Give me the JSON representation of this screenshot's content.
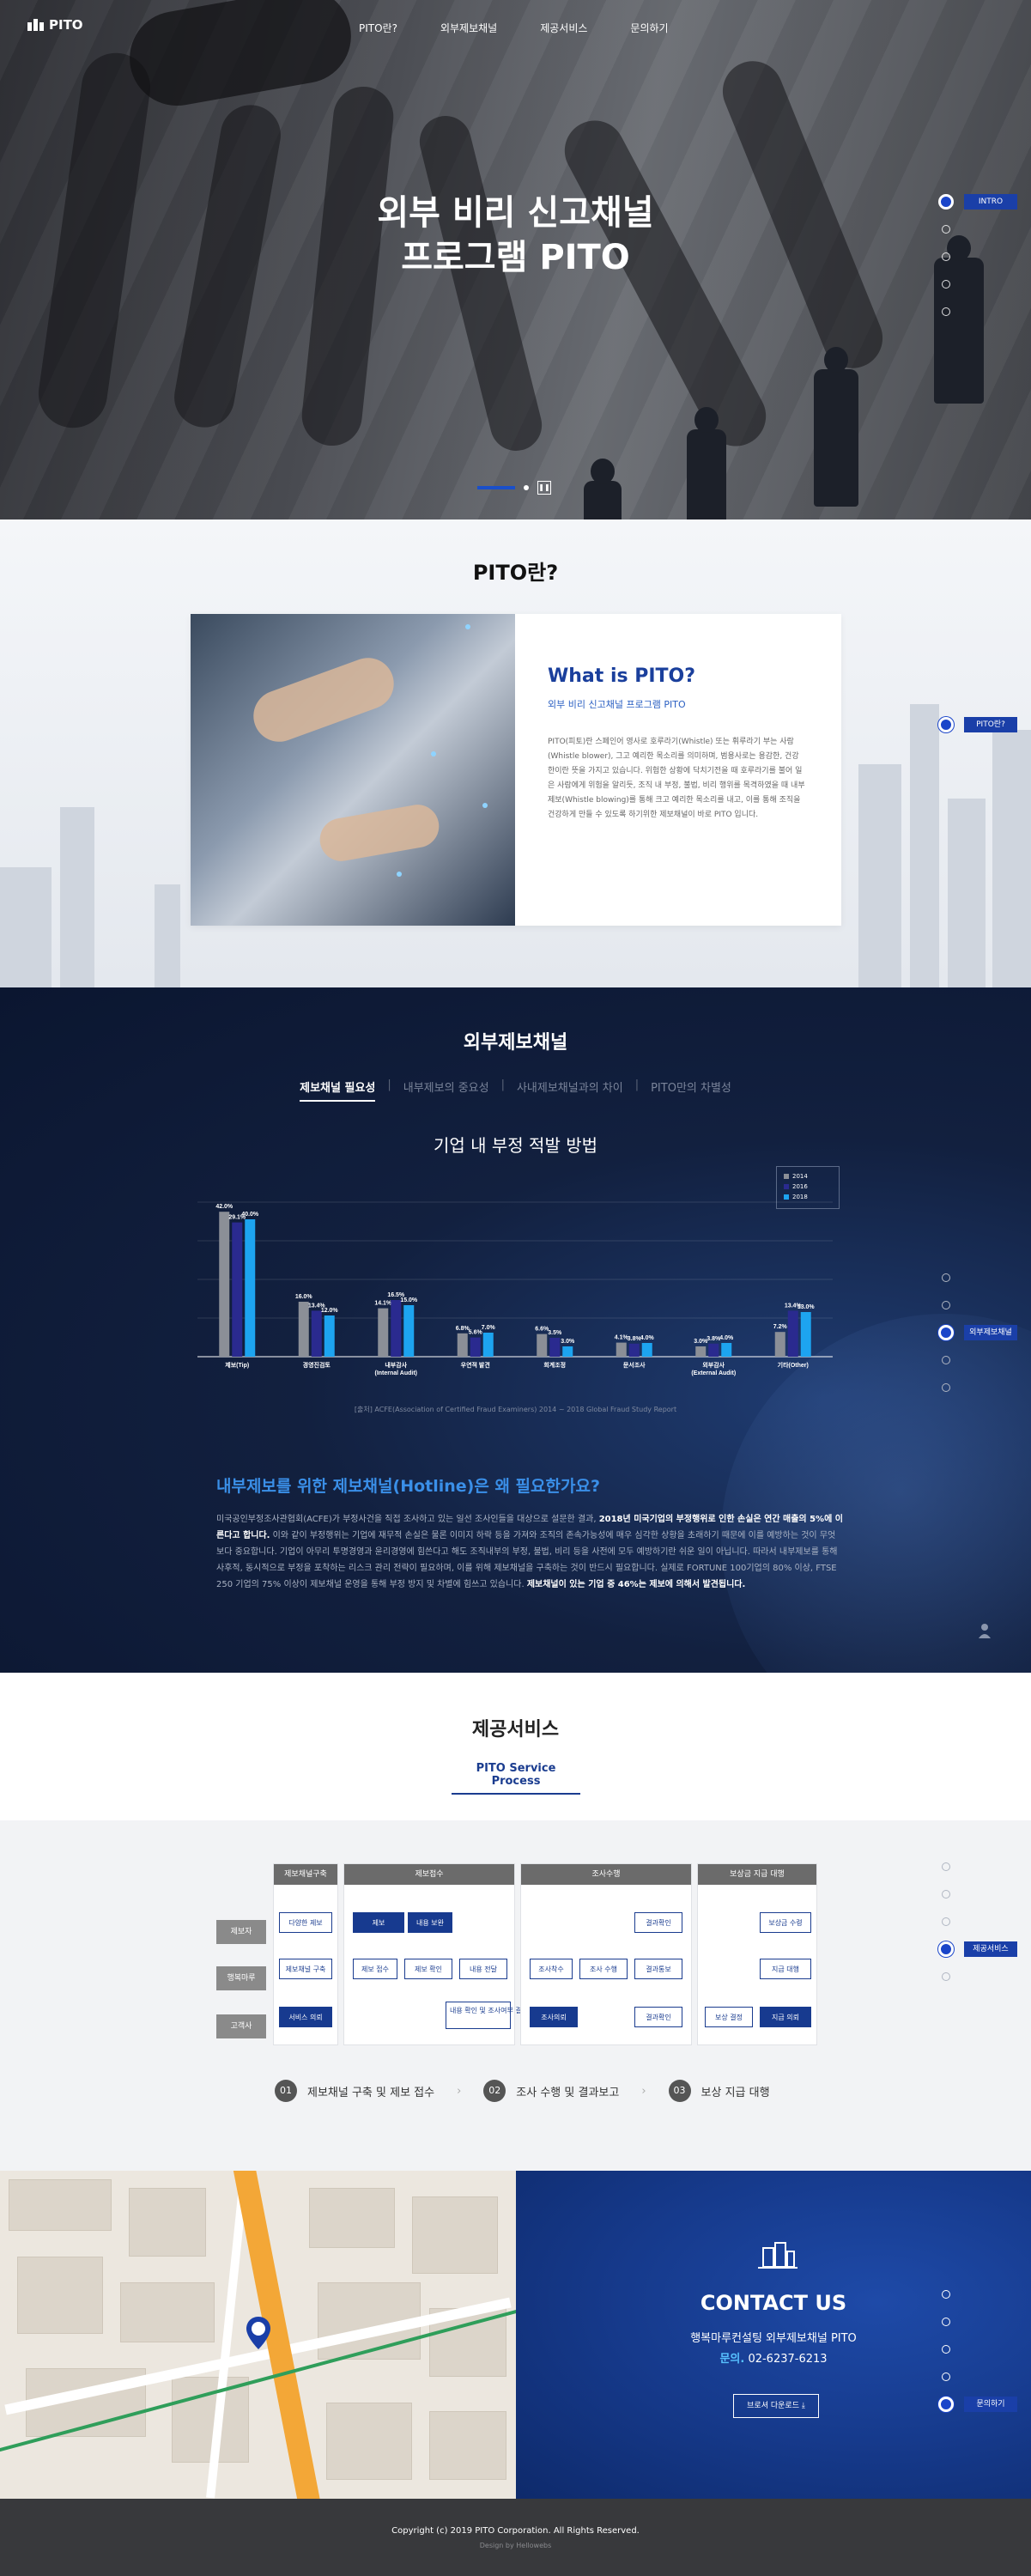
{
  "header": {
    "logo": "PITO",
    "nav": [
      "PITO란?",
      "외부제보채널",
      "제공서비스",
      "문의하기"
    ]
  },
  "hero": {
    "title_line1": "외부 비리 신고채널",
    "title_line2": "프로그램 PITO"
  },
  "sidenav": {
    "labels": [
      "INTRO",
      "PITO란?",
      "외부제보채널",
      "제공서비스",
      "문의하기"
    ]
  },
  "about": {
    "heading": "PITO란?",
    "title": "What is PITO?",
    "subtitle": "외부 비리 신고채널 프로그램 PITO",
    "paragraph": "PITO(피토)란 스페인어 영사로 호루라기(Whistle) 또는 휘루라기 부는 사람(Whistle blower), 그고 예리한 목소리를 의미하며, 범용사로는 용감한, 건강한이란 뜻을 가지고 있습니다. 위험한 상황에 닥치기전을 때 호루라기를 불어 일은 사람에게 위험을 알리듯, 조직 내 부정, 불법, 비리 행위를 목격하였을 때 내부제보(Whistle blowing)를 통해 크고 예리한 목소리를 내고, 이를 통해 조직을 건강하게 만들 수 있도록 하기위한 제보채널이 바로 PITO 입니다."
  },
  "channel": {
    "heading": "외부제보채널",
    "tabs": [
      "제보채널 필요성",
      "내부제보의 중요성",
      "사내제보채널과의 차이",
      "PITO만의 차별성"
    ],
    "chart_title": "기업 내 부정 적발 방법",
    "source": "[출처] ACFE(Association of Certified Fraud Examiners) 2014 ~ 2018 Global Fraud Study Report",
    "q_title": "내부제보를 위한 제보채널(Hotline)은 왜 필요한가요?",
    "body_1": "미국공인부정조사관협회(ACFE)가 부정사건을 직접 조사하고 있는 일선 조사인들을 대상으로 설문한 결과, ",
    "body_b1": "2018년 미국기업의 부정행위로 인한 손실은 연간 매출의 5%에 이른다고 합니다.",
    "body_2": " 이와 같이 부정행위는 기업에 재무적 손실은 물론 이미지 하락 등을 가져와 조직의 존속가능성에 매우 심각한 상황을 초래하기 때문에 이를 예방하는 것이 무엇보다 중요합니다. 기업이 아무리 투명경영과 윤리경영에 힘쓴다고 해도 조직내부의 부정, 불법, 비리 등을 사전에 모두 예방하기란 쉬운 일이 아닙니다. 따라서 내부제보를 통해 사후적, 동시적으로 부정을 포착하는 리스크 관리 전략이 필요하며, 이를 위해 제보채널을 구축하는 것이 반드시 필요합니다. 실제로 FORTUNE 100기업의 80% 이상, FTSE 250 기업의 75% 이상이 제보채널 운영을 통해 부정 방지 및 차별에 힘쓰고 있습니다. ",
    "body_b2": "제보채널이 있는 기업 중 46%는 제보에 의해서 발견됩니다."
  },
  "chart_data": {
    "type": "bar",
    "title": "기업 내 부정 적발 방법",
    "categories": [
      "제보(Tip)",
      "경영진검토",
      "내부감사\n(Internal Audit)",
      "우연적 발견",
      "회계조정",
      "문서조사",
      "외부감사\n(External Audit)",
      "기타(Other)"
    ],
    "series": [
      {
        "name": "2014",
        "values": [
          42.2,
          16.0,
          14.1,
          6.8,
          6.6,
          4.1,
          3.0,
          7.2
        ]
      },
      {
        "name": "2016",
        "values": [
          39.1,
          13.4,
          16.5,
          5.6,
          5.5,
          3.8,
          3.8,
          13.4
        ]
      },
      {
        "name": "2018",
        "values": [
          40.0,
          12.0,
          15.0,
          7.0,
          3.0,
          4.0,
          4.0,
          13.0
        ]
      }
    ],
    "labels": [
      [
        "42.0%",
        "29.1%",
        "40.0%"
      ],
      [
        "16.0%",
        "13.4%",
        "12.0%"
      ],
      [
        "14.1%",
        "16.5%",
        "15.0%"
      ],
      [
        "6.8%",
        "5.6%",
        "7.0%"
      ],
      [
        "6.6%",
        "3.5%",
        "3.0%"
      ],
      [
        "4.1%",
        "3.8%",
        "4.0%"
      ],
      [
        "3.0%",
        "3.8%",
        "4.0%"
      ],
      [
        "7.2%",
        "13.4%",
        "13.0%"
      ]
    ],
    "ylim": [
      0,
      45
    ],
    "legend_position": "top-right",
    "colors": [
      "#8b8f97",
      "#2a2a8f",
      "#1da4f0"
    ]
  },
  "service": {
    "heading": "제공서비스",
    "subtitle": "PITO Service Process",
    "col_heads": [
      "제보채널구축",
      "제보접수",
      "조사수행",
      "보상금 지급 대행"
    ],
    "rows": [
      "제보자",
      "행복마루",
      "고객사"
    ],
    "boxes": {
      "a1": "다양한 제보",
      "a2": "제보채널 구축",
      "a3": "서비스 의뢰",
      "b1": "제보",
      "b2": "내용 보완",
      "b3": "제보 접수",
      "b4": "제보 확인",
      "b5": "내용 전달",
      "b6": "내용 확인 및\n조사여부 결정",
      "c1": "결과확인",
      "c2": "조사착수",
      "c3": "조사 수행",
      "c4": "결과통보",
      "c5": "조사의뢰",
      "c6": "결과확인",
      "d1": "보상금 수령",
      "d2": "지급 대행",
      "d3": "보상 결정",
      "d4": "지급 의뢰"
    },
    "steps": [
      {
        "n": "01",
        "t": "제보채널 구축 및 제보 접수"
      },
      {
        "n": "02",
        "t": "조사 수행 및 결과보고"
      },
      {
        "n": "03",
        "t": "보상 지급 대행"
      }
    ]
  },
  "contact": {
    "title": "CONTACT US",
    "company": "행복마루컨설팅 외부제보채널 PITO",
    "phone_label": "문의.",
    "phone": "02-6237-6213",
    "download": "브로셔 다운로드"
  },
  "footer": {
    "copyright": "Copyright (c) 2019 PITO Corporation. All Rights Reserved.",
    "design": "Design by Hellowebs"
  }
}
